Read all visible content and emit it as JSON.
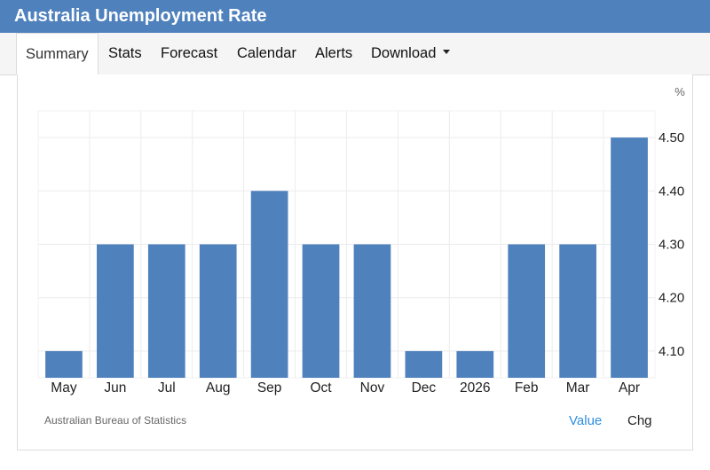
{
  "header": {
    "title": "Australia Unemployment Rate"
  },
  "tabs": [
    {
      "label": "Summary",
      "active": true
    },
    {
      "label": "Stats",
      "active": false
    },
    {
      "label": "Forecast",
      "active": false
    },
    {
      "label": "Calendar",
      "active": false
    },
    {
      "label": "Alerts",
      "active": false
    },
    {
      "label": "Download",
      "active": false,
      "dropdown": true
    }
  ],
  "footer": {
    "source": "Australian Bureau of Statistics",
    "value_toggle": "Value",
    "chg_toggle": "Chg"
  },
  "colors": {
    "bar": "#4f81bd",
    "header": "#4f81bd",
    "link": "#2f8fe0"
  },
  "chart_data": {
    "type": "bar",
    "categories": [
      "May",
      "Jun",
      "Jul",
      "Aug",
      "Sep",
      "Oct",
      "Nov",
      "Dec",
      "2026",
      "Feb",
      "Mar",
      "Apr"
    ],
    "values": [
      4.1,
      4.3,
      4.3,
      4.3,
      4.4,
      4.3,
      4.3,
      4.1,
      4.1,
      4.3,
      4.3,
      4.5
    ],
    "unit": "%",
    "ylim": [
      4.05,
      4.55
    ],
    "yticks": [
      "4.10",
      "4.20",
      "4.30",
      "4.40",
      "4.50"
    ],
    "y_axis_side": "right",
    "grid": true
  }
}
